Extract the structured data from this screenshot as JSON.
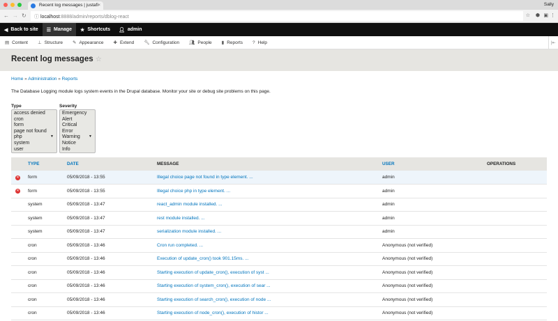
{
  "browser": {
    "tab_title": "Recent log messages | justafi",
    "url_host": "localhost",
    "url_rest": ":8888/admin/reports/dblog-react",
    "profile": "Sally"
  },
  "toolbar": {
    "back": "Back to site",
    "manage": "Manage",
    "shortcuts": "Shortcuts",
    "user": "admin"
  },
  "menu": [
    "Content",
    "Structure",
    "Appearance",
    "Extend",
    "Configuration",
    "People",
    "Reports",
    "Help"
  ],
  "page": {
    "title": "Recent log messages",
    "breadcrumb": [
      "Home",
      "Administration",
      "Reports"
    ],
    "description": "The Database Logging module logs system events in the Drupal database. Monitor your site or debug site problems on this page."
  },
  "filters": {
    "type_label": "Type",
    "type_options": [
      "access denied",
      "cron",
      "form",
      "page not found",
      "php",
      "system",
      "user"
    ],
    "severity_label": "Severity",
    "severity_options": [
      "Emergency",
      "Alert",
      "Critical",
      "Error",
      "Warning",
      "Notice",
      "Info"
    ]
  },
  "table": {
    "headers": [
      "TYPE",
      "DATE",
      "MESSAGE",
      "USER",
      "OPERATIONS"
    ],
    "rows": [
      {
        "error": true,
        "type": "form",
        "date": "05/09/2018 - 13:55",
        "message": "Illegal choice page not found in type element. ...",
        "user": "admin"
      },
      {
        "error": true,
        "type": "form",
        "date": "05/09/2018 - 13:55",
        "message": "Illegal choice php in type element. ...",
        "user": "admin"
      },
      {
        "error": false,
        "type": "system",
        "date": "05/09/2018 - 13:47",
        "message": "react_admin module installed. ...",
        "user": "admin"
      },
      {
        "error": false,
        "type": "system",
        "date": "05/09/2018 - 13:47",
        "message": "rest module installed. ...",
        "user": "admin"
      },
      {
        "error": false,
        "type": "system",
        "date": "05/09/2018 - 13:47",
        "message": "serialization module installed. ...",
        "user": "admin"
      },
      {
        "error": false,
        "type": "cron",
        "date": "05/09/2018 - 13:46",
        "message": "Cron run completed. ...",
        "user": "Anonymous (not verified)"
      },
      {
        "error": false,
        "type": "cron",
        "date": "05/09/2018 - 13:46",
        "message": "Execution of update_cron() took 901.15ms. ...",
        "user": "Anonymous (not verified)"
      },
      {
        "error": false,
        "type": "cron",
        "date": "05/09/2018 - 13:46",
        "message": "Starting execution of update_cron(), execution of syst ...",
        "user": "Anonymous (not verified)"
      },
      {
        "error": false,
        "type": "cron",
        "date": "05/09/2018 - 13:46",
        "message": "Starting execution of system_cron(), execution of sear ...",
        "user": "Anonymous (not verified)"
      },
      {
        "error": false,
        "type": "cron",
        "date": "05/09/2018 - 13:46",
        "message": "Starting execution of search_cron(), execution of node ...",
        "user": "Anonymous (not verified)"
      },
      {
        "error": false,
        "type": "cron",
        "date": "05/09/2018 - 13:46",
        "message": "Starting execution of node_cron(), execution of histor ...",
        "user": "Anonymous (not verified)"
      }
    ]
  }
}
